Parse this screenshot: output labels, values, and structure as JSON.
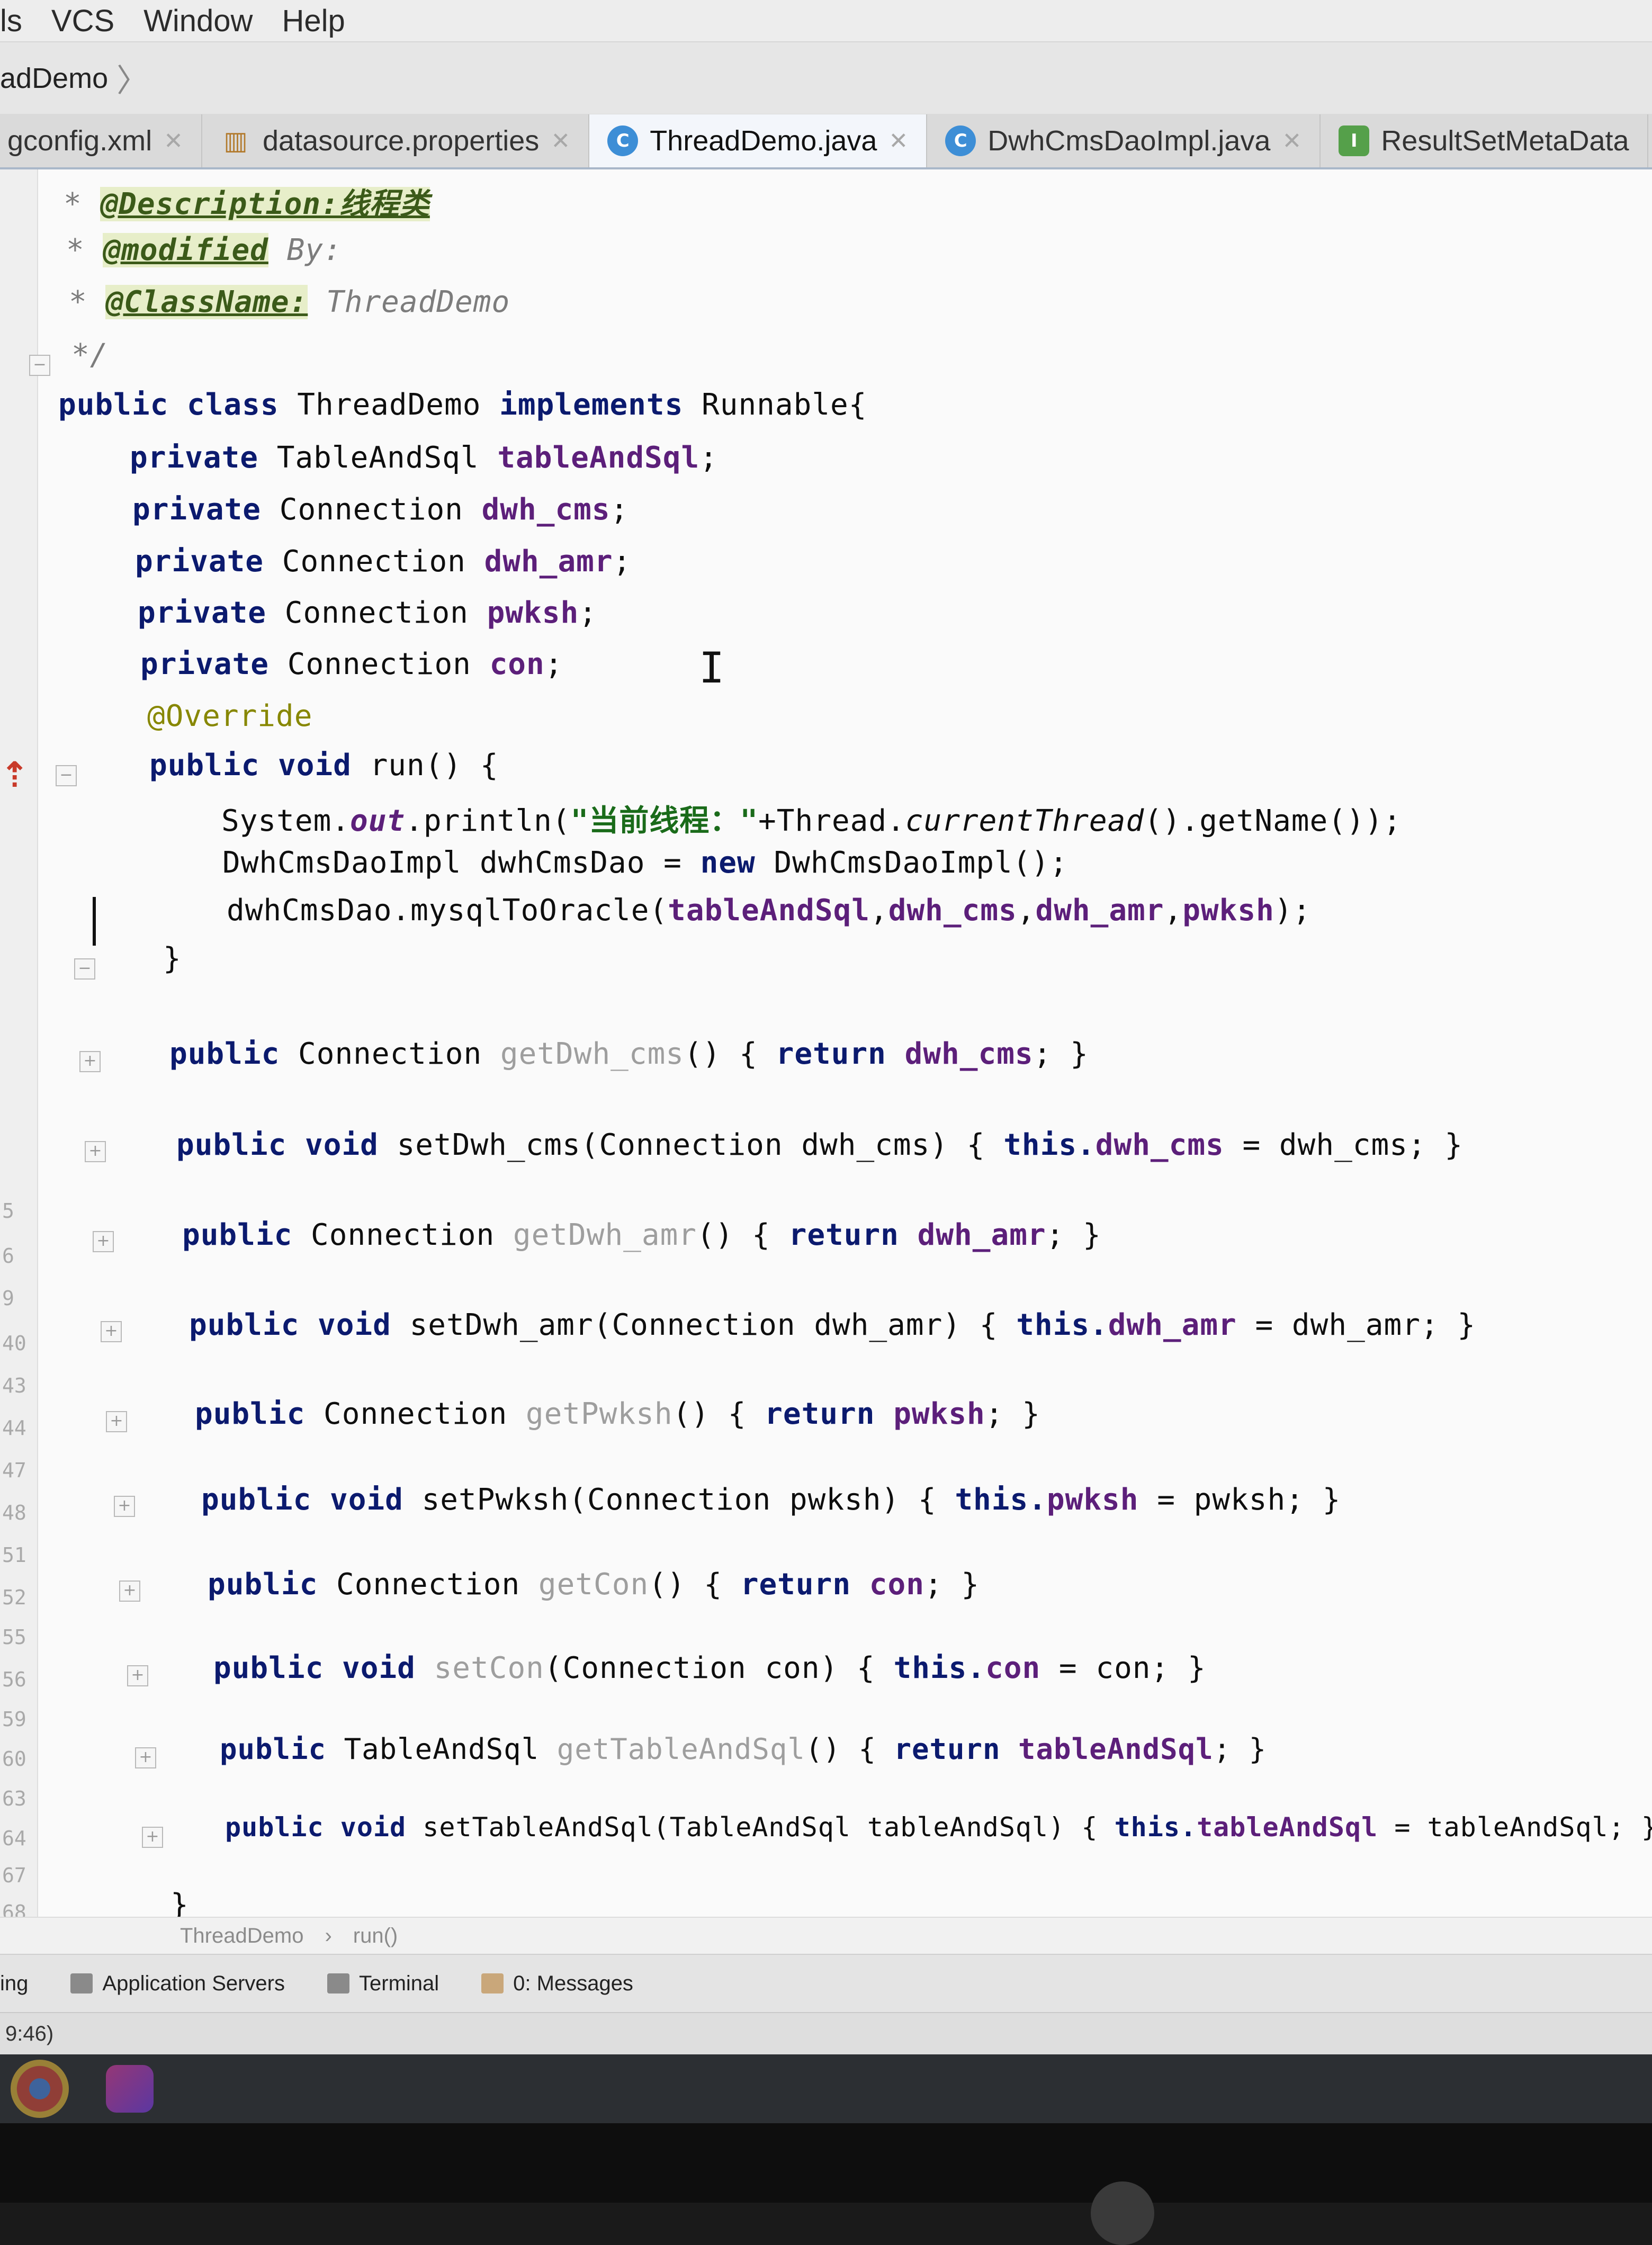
{
  "menu": [
    "ls",
    "VCS",
    "Window",
    "Help"
  ],
  "breadcrumb": {
    "project": "adDemo"
  },
  "tabs": [
    {
      "label": "gconfig.xml",
      "icon": "xml-file-icon",
      "active": false
    },
    {
      "label": "datasource.properties",
      "icon": "properties-file-icon",
      "active": false
    },
    {
      "label": "ThreadDemo.java",
      "icon": "java-class-icon",
      "active": true
    },
    {
      "label": "DwhCmsDaoImpl.java",
      "icon": "java-class-icon",
      "active": false
    },
    {
      "label": "ResultSetMetaData",
      "icon": "interface-icon",
      "active": false
    }
  ],
  "gutter_numbers": [
    "5",
    "6",
    "9",
    "40",
    "43",
    "44",
    "47",
    "48",
    "51",
    "52",
    "55",
    "56",
    "59",
    "60",
    "63",
    "64",
    "67",
    "68"
  ],
  "code": {
    "c1_star": "* ",
    "c1_tag": "@Description:线程类",
    "c2_star": "* ",
    "c2_tag": "@modified",
    "c2_rest": " By:",
    "c3_star": "* ",
    "c3_tag": "@ClassName:",
    "c3_rest": " ThreadDemo",
    "c4": "*/",
    "class_kw1": "public class",
    "class_name": " ThreadDemo ",
    "class_kw2": "implements",
    "class_rest": " Runnable{",
    "f1_kw": "private",
    "f1_type": " TableAndSql ",
    "f1_name": "tableAndSql",
    "f1_end": ";",
    "f2_kw": "private",
    "f2_type": " Connection ",
    "f2_name": "dwh_cms",
    "f2_end": ";",
    "f3_kw": "private",
    "f3_type": " Connection ",
    "f3_name": "dwh_amr",
    "f3_end": ";",
    "f4_kw": "private",
    "f4_type": " Connection ",
    "f4_name": "pwksh",
    "f4_end": ";",
    "f5_kw": "private",
    "f5_type": " Connection ",
    "f5_name": "con",
    "f5_end": ";",
    "override": "@Override",
    "run_kw": "public void",
    "run_rest": " run() {",
    "p1_a": "System.",
    "p1_out": "out",
    "p1_b": ".println(",
    "p1_str": "\"当前线程：\"",
    "p1_c": "+Thread.",
    "p1_ital": "currentThread",
    "p1_d": "().getName());",
    "p2_a": "DwhCmsDaoImpl dwhCmsDao = ",
    "p2_new": "new",
    "p2_b": " DwhCmsDaoImpl();",
    "p3_a": "dwhCmsDao.mysqlToOracle(",
    "p3_f1": "tableAndSql",
    "p3_s1": ",",
    "p3_f2": "dwh_cms",
    "p3_s2": ",",
    "p3_f3": "dwh_amr",
    "p3_s3": ",",
    "p3_f4": "pwksh",
    "p3_end": ");",
    "run_close": "}",
    "m1_kw": "public",
    "m1_type": " Connection ",
    "m1_name": "getDwh_cms",
    "m1_a": "() { ",
    "m1_ret": "return",
    "m1_sp": " ",
    "m1_fld": "dwh_cms",
    "m1_end": "; }",
    "m2_kw": "public void",
    "m2_a": " setDwh_cms(Connection dwh_cms) { ",
    "m2_this": "this.",
    "m2_fld": "dwh_cms",
    "m2_end": " = dwh_cms; }",
    "m3_kw": "public",
    "m3_type": " Connection ",
    "m3_name": "getDwh_amr",
    "m3_a": "() { ",
    "m3_ret": "return",
    "m3_sp": " ",
    "m3_fld": "dwh_amr",
    "m3_end": "; }",
    "m4_kw": "public void",
    "m4_a": " setDwh_amr(Connection dwh_amr) { ",
    "m4_this": "this.",
    "m4_fld": "dwh_amr",
    "m4_end": " = dwh_amr; }",
    "m5_kw": "public",
    "m5_type": " Connection ",
    "m5_name": "getPwksh",
    "m5_a": "() { ",
    "m5_ret": "return",
    "m5_sp": " ",
    "m5_fld": "pwksh",
    "m5_end": "; }",
    "m6_kw": "public void",
    "m6_a": " setPwksh(Connection pwksh) { ",
    "m6_this": "this.",
    "m6_fld": "pwksh",
    "m6_end": " = pwksh; }",
    "m7_kw": "public",
    "m7_type": " Connection ",
    "m7_name": "getCon",
    "m7_a": "() { ",
    "m7_ret": "return",
    "m7_sp": " ",
    "m7_fld": "con",
    "m7_end": "; }",
    "m8_kw": "public void",
    "m8_sp": " ",
    "m8_name": "setCon",
    "m8_a": "(Connection con) { ",
    "m8_this": "this.",
    "m8_fld": "con",
    "m8_end": " = con; }",
    "m9_kw": "public",
    "m9_type": " TableAndSql ",
    "m9_name": "getTableAndSql",
    "m9_a": "() { ",
    "m9_ret": "return",
    "m9_sp": " ",
    "m9_fld": "tableAndSql",
    "m9_end": "; }",
    "m10_kw": "public void",
    "m10_a": " setTableAndSql(TableAndSql tableAndSql) { ",
    "m10_this": "this.",
    "m10_fld": "tableAndSql",
    "m10_end": " = tableAndSql; }",
    "class_close": "}"
  },
  "editor_breadcrumb": {
    "class": "ThreadDemo",
    "separator": "›",
    "method": "run()"
  },
  "tool_windows": {
    "first": "ing",
    "app_servers": "Application Servers",
    "terminal": "Terminal",
    "messages": "0: Messages"
  },
  "status": {
    "position": "9:46)"
  }
}
